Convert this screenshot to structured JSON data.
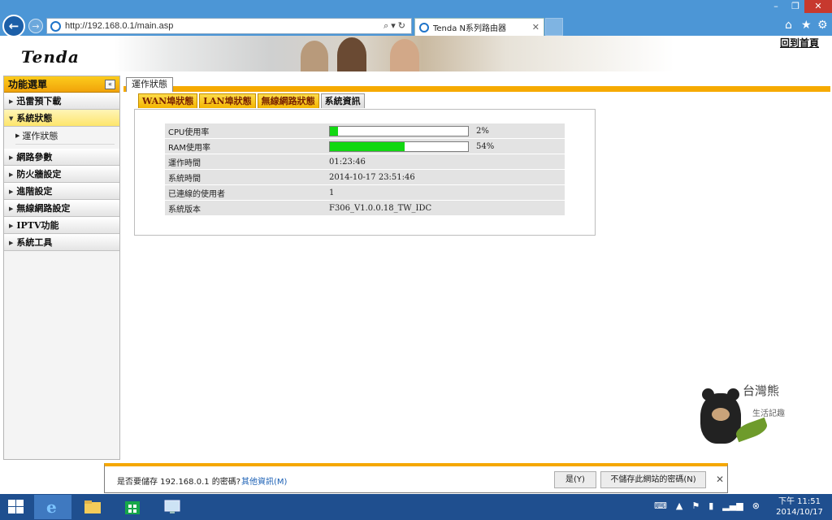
{
  "browser": {
    "url": "http://192.168.0.1/main.asp",
    "tab_title": "Tenda N系列路由器"
  },
  "header": {
    "logo": "Tenda",
    "home_link": "回到首頁"
  },
  "sidebar": {
    "title": "功能選單",
    "items": [
      {
        "label": "迅雷預下載"
      },
      {
        "label": "系統狀態",
        "active": true,
        "subitems": [
          {
            "label": "運作狀態"
          }
        ]
      },
      {
        "label": "網路參數"
      },
      {
        "label": "防火牆設定"
      },
      {
        "label": "進階設定"
      },
      {
        "label": "無線網路設定"
      },
      {
        "label": "IPTV功能"
      },
      {
        "label": "系統工具"
      }
    ]
  },
  "main": {
    "page_tab": "運作狀態",
    "sub_tabs": [
      "WAN埠狀態",
      "LAN埠狀態",
      "無線網路狀態",
      "系統資訊"
    ],
    "current_sub_tab": "系統資訊",
    "rows": [
      {
        "label": "CPU使用率",
        "value": "2%",
        "fill": 0.06
      },
      {
        "label": "RAM使用率",
        "value": "54%",
        "fill": 0.54
      },
      {
        "label": "運作時間",
        "value": "01:23:46"
      },
      {
        "label": "系統時間",
        "value": "2014-10-17 23:51:46"
      },
      {
        "label": "已連線的使用者",
        "value": "1"
      },
      {
        "label": "系統版本",
        "value": "F306_V1.0.0.18_TW_IDC"
      }
    ],
    "bar_color": "#11d811",
    "accent_color": "#f6aa00"
  },
  "notification": {
    "message": "是否要儲存 192.168.0.1 的密碼?",
    "more_info": "其他資訊(M)",
    "yes": "是(Y)",
    "never": "不儲存此網站的密碼(N)"
  },
  "watermark": {
    "title": "台灣熊",
    "subtitle": "生活記趣"
  },
  "taskbar": {
    "time": "下午 11:51",
    "date": "2014/10/17"
  }
}
